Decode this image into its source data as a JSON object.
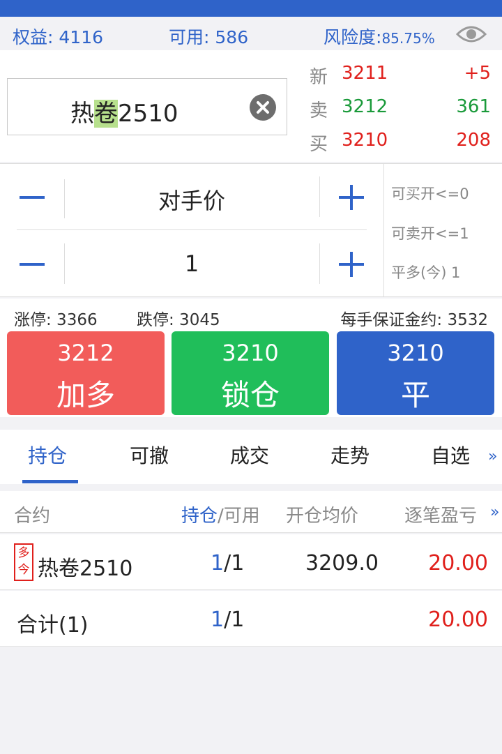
{
  "account": {
    "equity_label": "权益:",
    "equity_value": "4116",
    "available_label": "可用:",
    "available_value": "586",
    "risk_label": "风险度:",
    "risk_value": "85.75%"
  },
  "contract": {
    "code_prefix": "热",
    "code_highlight": "卷",
    "code_suffix": "2510"
  },
  "quotes": [
    {
      "label": "新",
      "price": "3211",
      "volume": "+5"
    },
    {
      "label": "卖",
      "price": "3212",
      "volume": "361"
    },
    {
      "label": "买",
      "price": "3210",
      "volume": "208"
    }
  ],
  "order": {
    "price_type": "对手价",
    "quantity": "1"
  },
  "limits": {
    "buy_open": "可买开<=0",
    "sell_open": "可卖开<=1",
    "close_long": "平多(今) 1"
  },
  "info": {
    "limit_up": "涨停: 3366",
    "limit_down": "跌停: 3045",
    "margin": "每手保证金约: 3532"
  },
  "buttons": [
    {
      "price": "3212",
      "label": "加多",
      "color": "#f25c5a"
    },
    {
      "price": "3210",
      "label": "锁仓",
      "color": "#20be5a"
    },
    {
      "price": "3210",
      "label": "平",
      "color": "#2f63c9"
    }
  ],
  "tabs": [
    "持仓",
    "可撤",
    "成交",
    "走势",
    "自选"
  ],
  "tab_more": "»",
  "table": {
    "headers": {
      "contract": "合约",
      "position": "持仓",
      "available": "/可用",
      "avg_price": "开仓均价",
      "pnl": "逐笔盈亏",
      "more": "»"
    },
    "rows": [
      {
        "tag_line1": "多",
        "tag_line2": "今",
        "contract": "热卷2510",
        "pos": "1",
        "avail": "/1",
        "avg_price": "3209.0",
        "pnl": "20.00"
      }
    ],
    "total": {
      "label": "合计(1)",
      "pos": "1",
      "avail": "/1",
      "pnl": "20.00"
    }
  },
  "colors": {
    "accent": "#2f63c9",
    "up": "#e0201c",
    "down": "#1a9a3a"
  }
}
